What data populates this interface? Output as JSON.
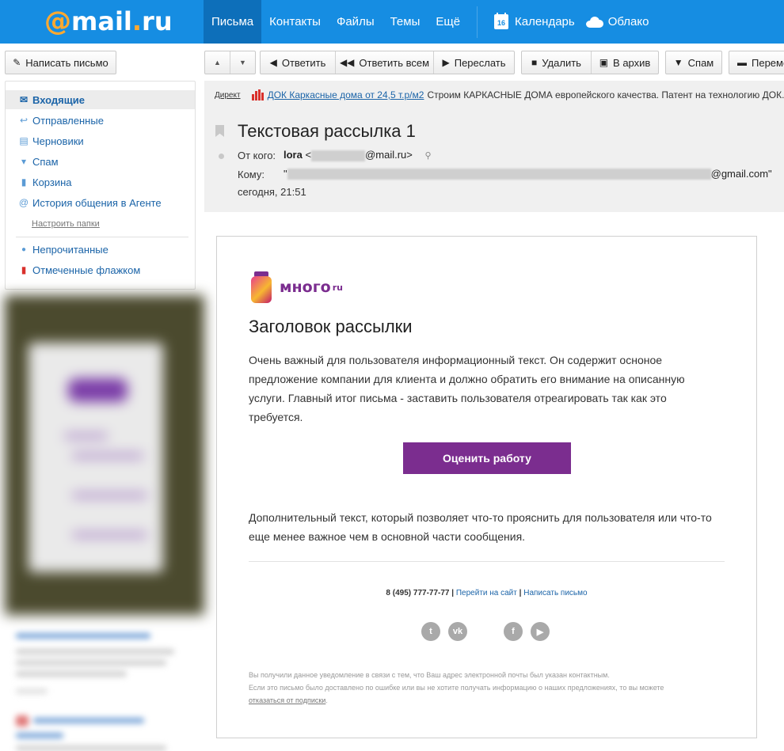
{
  "header": {
    "logo_at": "@",
    "logo_mail": "mail",
    "logo_dot": ".",
    "logo_ru": "ru",
    "nav": [
      "Письма",
      "Контакты",
      "Файлы",
      "Темы",
      "Ещё"
    ],
    "calendar_day": "16",
    "calendar_label": "Календарь",
    "cloud_label": "Облако"
  },
  "toolbar": {
    "compose": "Написать письмо",
    "reply": "Ответить",
    "reply_all": "Ответить всем",
    "forward": "Переслать",
    "delete": "Удалить",
    "archive": "В архив",
    "spam": "Спам",
    "move": "Переместить"
  },
  "sidebar": {
    "folders": [
      {
        "label": "Входящие",
        "icon": "envelope-icon"
      },
      {
        "label": "Отправленные",
        "icon": "reply-arrow-icon"
      },
      {
        "label": "Черновики",
        "icon": "draft-icon"
      },
      {
        "label": "Спам",
        "icon": "thumbs-down-icon"
      },
      {
        "label": "Корзина",
        "icon": "trash-icon"
      },
      {
        "label": "История общения в Агенте",
        "icon": "at-icon"
      }
    ],
    "settings_link": "Настроить папки",
    "filters": [
      {
        "label": "Непрочитанные",
        "icon": "unread-dot-icon"
      },
      {
        "label": "Отмеченные флажком",
        "icon": "flag-icon"
      }
    ]
  },
  "ad": {
    "direct": "Директ",
    "link": "ДОК Каркасные дома от 24,5 т.р/м2",
    "text": "Строим КАРКАСНЫЕ ДОМА европейского качества. Патент на технологию ДОК."
  },
  "message": {
    "subject": "Текстовая рассылка 1",
    "from_label": "От кого:",
    "from_name": "lora",
    "from_prefix": "<",
    "from_domain": "@mail.ru>",
    "to_label": "Кому:",
    "to_prefix": "\"",
    "to_domain": "@gmail.com\"",
    "date": "сегодня, 21:51"
  },
  "email": {
    "brand": "много",
    "brand_sup": "ru",
    "heading": "Заголовок рассылки",
    "body": "Очень важный для пользователя информационный текст. Он содержит осноное предложение компании для клиента и должно обратить его внимание на описанную услуги. Главный итог письма - заставить пользователя отреагировать так как это требуется.",
    "cta": "Оценить работу",
    "body2": "Дополнительный текст, который позволяет что-то прояснить для пользователя или что-то еще менее важное чем в основной части сообщения.",
    "phone": "8 (495) 777-77-77",
    "sep": "|",
    "site_link": "Перейти на сайт",
    "write_link": "Написать письмо",
    "socials": [
      "twitter-icon",
      "vk-icon",
      "facebook-icon",
      "youtube-icon"
    ],
    "footer_line1": "Вы получили данное уведомление в связи с тем, что Ваш адрес электронной почты был указан контактным.",
    "footer_line2": "Если это письмо было доставлено по ошибке или вы не хотите получать информацию о наших предложениях, то вы можете",
    "unsubscribe": "отказаться от подписки",
    "footer_end": "."
  },
  "colors": {
    "topbar": "#168de2",
    "accent_purple": "#7b2d8f",
    "link_blue": "#1b64a8",
    "logo_orange": "#ffa930"
  }
}
